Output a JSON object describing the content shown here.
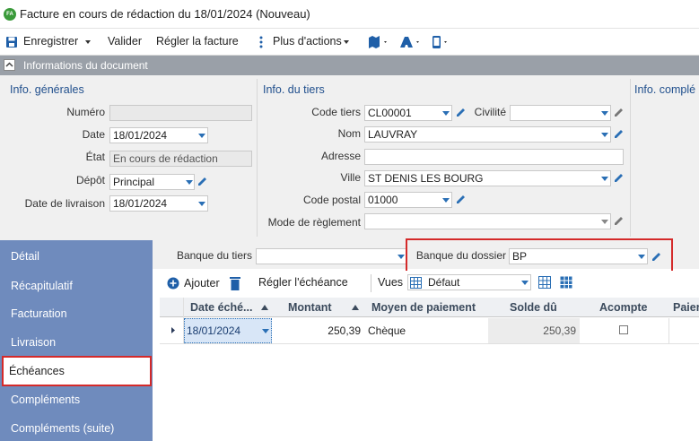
{
  "window": {
    "title": "Facture en cours de rédaction du 18/01/2024 (Nouveau)",
    "badge": "FA"
  },
  "toolbar": {
    "save_label": "Enregistrer",
    "validate_label": "Valider",
    "pay_label": "Régler la facture",
    "more_label": "Plus d'actions"
  },
  "document_info": {
    "header": "Informations du document",
    "general": {
      "title": "Info. générales",
      "numero_label": "Numéro",
      "numero_value": "",
      "date_label": "Date",
      "date_value": "18/01/2024",
      "etat_label": "État",
      "etat_value": "En cours de rédaction",
      "depot_label": "Dépôt",
      "depot_value": "Principal",
      "livraison_label": "Date de livraison",
      "livraison_value": "18/01/2024"
    },
    "tiers": {
      "title": "Info. du tiers",
      "code_label": "Code tiers",
      "code_value": "CL00001",
      "civilite_label": "Civilité",
      "civilite_value": "",
      "nom_label": "Nom",
      "nom_value": "LAUVRAY",
      "adresse_label": "Adresse",
      "adresse_value": "",
      "ville_label": "Ville",
      "ville_value": "ST DENIS LES BOURG",
      "cp_label": "Code postal",
      "cp_value": "01000",
      "reglement_label": "Mode de règlement",
      "reglement_value": ""
    },
    "compl": {
      "title": "Info. complé"
    }
  },
  "sidebar": {
    "items": [
      {
        "label": "Détail"
      },
      {
        "label": "Récapitulatif"
      },
      {
        "label": "Facturation"
      },
      {
        "label": "Livraison"
      },
      {
        "label": "Échéances"
      },
      {
        "label": "Compléments"
      },
      {
        "label": "Compléments (suite)"
      }
    ]
  },
  "banks": {
    "tiers_label": "Banque du tiers",
    "tiers_value": "",
    "dossier_label": "Banque du dossier",
    "dossier_value": "BP"
  },
  "schedule_toolbar": {
    "add_label": "Ajouter",
    "pay_label": "Régler l'échéance",
    "views_label": "Vues",
    "view_value": "Défaut"
  },
  "grid": {
    "columns": [
      "Date éché...",
      "Montant",
      "Moyen de paiement",
      "Solde dû",
      "Acompte",
      "Paier"
    ],
    "rows": [
      {
        "date": "18/01/2024",
        "montant": "250,39",
        "moyen": "Chèque",
        "solde": "250,39"
      }
    ]
  },
  "colors": {
    "sidebar": "#6f8bbd",
    "accent": "#2a6fb5",
    "highlight": "#d42a2a"
  }
}
